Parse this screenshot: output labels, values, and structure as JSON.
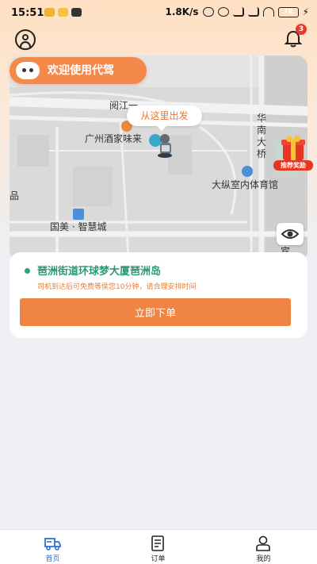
{
  "status_bar": {
    "time": "15:51",
    "network_speed": "1.8K/s",
    "battery": "78",
    "accent": "#2fae4a"
  },
  "header": {
    "user_icon": "user-circle-icon",
    "bell_icon": "bell-icon",
    "notification_count": "3"
  },
  "map": {
    "welcome_text": "欢迎使用代驾",
    "depart_label": "从这里出发",
    "place_labels": {
      "restaurant": "广州酒家味来",
      "stadium": "大纵室内体育馆",
      "mall": "国美 · 智慧城",
      "road_top": "阅江一",
      "bridge": "华南大桥",
      "edge_a": "品",
      "edge_b": "宾"
    },
    "reward_label": "推荐奖励"
  },
  "order": {
    "address": "琶洲街道环球梦大厦琶洲岛",
    "note": "司机到达后可免费等侯您10分钟，请合理安排时间",
    "submit_label": "立即下单",
    "accent": "#f08442"
  },
  "nav": {
    "items": [
      {
        "label": "首页",
        "icon": "car-icon",
        "active": true
      },
      {
        "label": "订单",
        "icon": "document-icon",
        "active": false
      },
      {
        "label": "我的",
        "icon": "profile-icon",
        "active": false
      }
    ]
  }
}
